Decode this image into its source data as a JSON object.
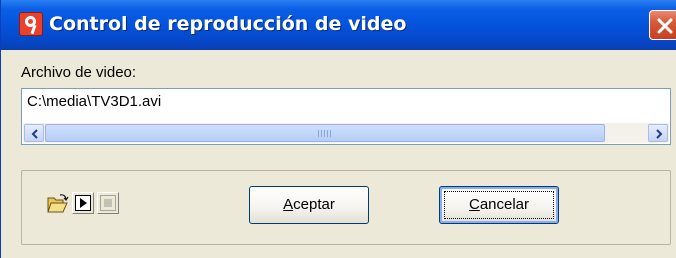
{
  "window": {
    "title": "Control de reproducción de video"
  },
  "form": {
    "file_label": "Archivo de video:",
    "file_path": "C:\\media\\TV3D1.avi"
  },
  "buttons": {
    "accept_mnemonic": "A",
    "accept_rest": "ceptar",
    "cancel_mnemonic": "C",
    "cancel_rest": "ancelar"
  },
  "icons": {
    "open": "open-folder-icon",
    "play": "play-icon",
    "stop": "stop-icon",
    "close": "close-icon"
  }
}
